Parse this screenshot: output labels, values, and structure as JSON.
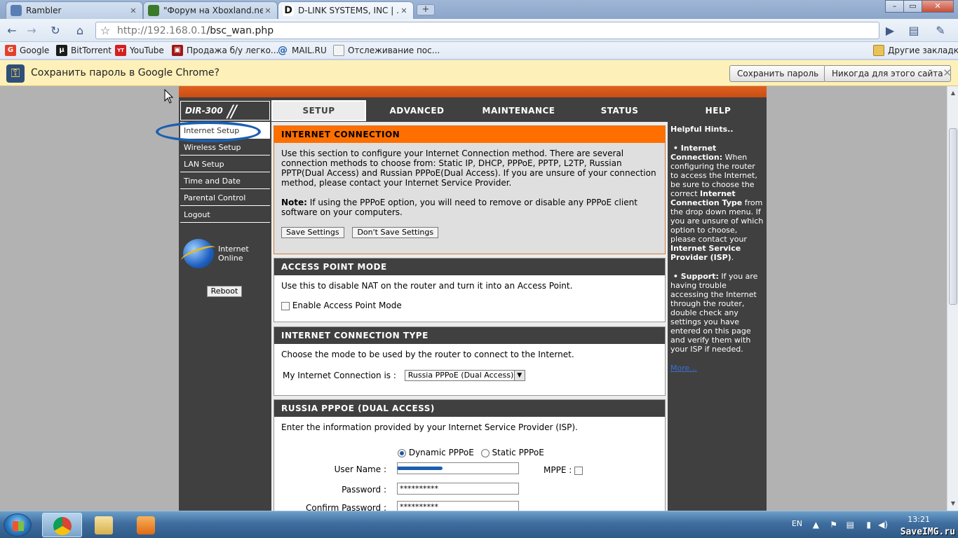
{
  "browser": {
    "tabs": [
      {
        "title": "Rambler",
        "favicon_color": "#5a7db3"
      },
      {
        "title": "\"Форум на Xboxland.net...",
        "favicon_color": "#3a7a2a"
      },
      {
        "title": "D-LINK SYSTEMS, INC | ...",
        "favicon_color": "#111111"
      }
    ],
    "url_host": "http://192.168.0.1",
    "url_path": "/bsc_wan.php",
    "bookmarks": [
      {
        "label": "Google",
        "color": "#e3402c"
      },
      {
        "label": "BitTorrent",
        "color": "#1a1a1a"
      },
      {
        "label": "YouTube",
        "color": "#d42020"
      },
      {
        "label": "Продажа б/у легко...",
        "color": "#a01818"
      },
      {
        "label": "MAIL.RU",
        "color": "#1e5fa8"
      },
      {
        "label": "Отслеживание пос...",
        "color": "#f4f4f4"
      }
    ],
    "other_bookmarks": "Другие закладки",
    "infobar": {
      "message": "Сохранить пароль в Google Chrome?",
      "save_label": "Сохранить пароль",
      "never_label": "Никогда для этого сайта"
    }
  },
  "router": {
    "model": "DIR-300",
    "tabs": [
      "SETUP",
      "ADVANCED",
      "MAINTENANCE",
      "STATUS",
      "HELP"
    ],
    "left_menu": [
      "Internet Setup",
      "Wireless Setup",
      "LAN Setup",
      "Time and Date",
      "Parental Control",
      "Logout"
    ],
    "status_line1": "Internet",
    "status_line2": "Online",
    "reboot_label": "Reboot",
    "internet_connection": {
      "title": "INTERNET CONNECTION",
      "description": "Use this section to configure your Internet Connection method. There are several connection methods to choose from: Static IP, DHCP, PPPoE, PPTP, L2TP, Russian PPTP(Dual Access) and Russian PPPoE(Dual Access). If you are unsure of your connection method, please contact your Internet Service Provider.",
      "note_label": "Note:",
      "note_text": "If using the PPPoE option, you will need to remove or disable any PPPoE client software on your computers.",
      "save_label": "Save Settings",
      "dont_save_label": "Don't Save Settings"
    },
    "access_point": {
      "title": "ACCESS POINT MODE",
      "description": "Use this to disable NAT on the router and turn it into an Access Point.",
      "checkbox_label": "Enable Access Point Mode"
    },
    "connection_type": {
      "title": "INTERNET CONNECTION TYPE",
      "description": "Choose the mode to be used by the router to connect to the Internet.",
      "field_label": "My Internet Connection is :",
      "selected": "Russia PPPoE (Dual Access)"
    },
    "pppoe": {
      "title": "RUSSIA PPPOE (DUAL ACCESS)",
      "description": "Enter the information provided by your Internet Service Provider (ISP).",
      "radio_dynamic": "Dynamic PPPoE",
      "radio_static": "Static PPPoE",
      "username_label": "User Name :",
      "mppe_label": "MPPE :",
      "password_label": "Password :",
      "password_value": "**********",
      "confirm_label": "Confirm Password :",
      "confirm_value": "**********"
    },
    "hints": {
      "title": "Helpful Hints..",
      "ic_title": "Internet Connection:",
      "ic_text1": "When configuring the router to access the Internet, be sure to choose the correct",
      "ic_bold": "Internet Connection Type",
      "ic_text2": "from the drop down menu. If you are unsure of which option to choose, please contact your",
      "ic_bold2": "Internet Service Provider (ISP)",
      "support_title": "Support:",
      "support_text": "If you are having trouble accessing the Internet through the router, double check any settings you have entered on this page and verify them with your ISP if needed.",
      "more": "More..."
    }
  },
  "taskbar": {
    "lang": "EN",
    "time": "13:21",
    "watermark": "SaveIMG.ru"
  }
}
